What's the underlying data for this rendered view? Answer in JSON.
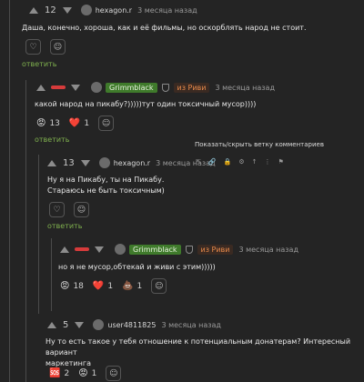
{
  "comments": [
    {
      "score": "12",
      "username": "hexagon.r",
      "date": "3 месяца назад",
      "text": "Даша, конечно, хороша, как и её фильмы, но оскорблять народ не стоит.",
      "reply_label": "ответить"
    },
    {
      "username": "Grimmblack",
      "from_badge": "из Риви",
      "date": "3 месяца назад",
      "text": "какой народ на пикабу?)))))тут один токсичный мусор))))",
      "reactions": [
        {
          "emoji": "😡",
          "count": "13"
        },
        {
          "emoji": "❤️",
          "count": "1"
        }
      ],
      "reply_label": "ответить"
    },
    {
      "score": "13",
      "username": "hexagon.r",
      "date": "3 месяца назад",
      "text_lines": [
        "Ну я на Пикабу, ты на Пикабу.",
        "Стараюсь не быть токсичным)"
      ],
      "reply_label": "ответить",
      "tooltip": "Показать/скрыть ветку комментариев"
    },
    {
      "username": "Grimmblack",
      "from_badge": "из Риви",
      "date": "3 месяца назад",
      "text": "но я не мусор,обтекай и живи с этим)))))",
      "reactions": [
        {
          "emoji": "😡",
          "count": "18"
        },
        {
          "emoji": "❤️",
          "count": "1"
        },
        {
          "emoji": "💩",
          "count": "1"
        }
      ]
    },
    {
      "score": "5",
      "username": "user4811825",
      "date": "3 месяца назад",
      "text_lines": [
        "Ну то есть такое у тебя отношение к потенциальным донатерам? Интересный вариант",
        "маркетинга"
      ],
      "reactions": [
        {
          "emoji": "🆘",
          "count": "2"
        },
        {
          "emoji": "😡",
          "count": "1"
        }
      ]
    }
  ]
}
